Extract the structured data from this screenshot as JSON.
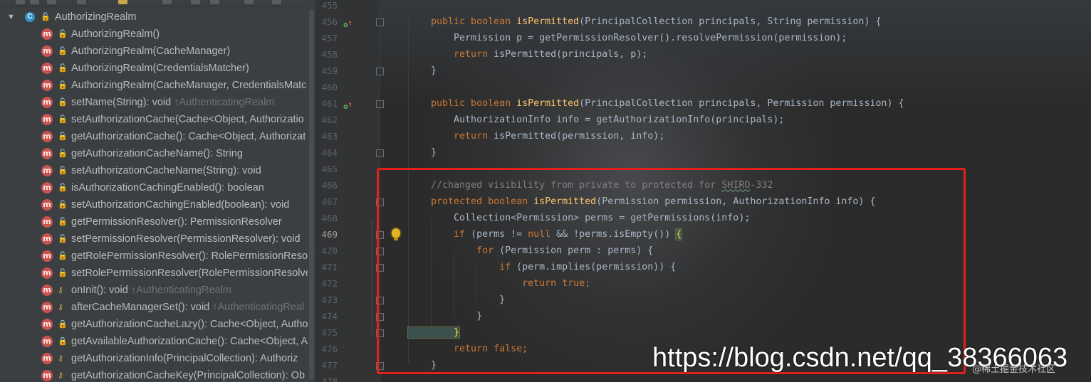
{
  "structure": {
    "root": {
      "label": "AuthorizingRealm",
      "class_icon_letter": "C",
      "arrow": "▼"
    },
    "member_icon_letter": "m",
    "visibility_glyphs": {
      "public": "🔓",
      "protected": "⚷",
      "private": "🔒"
    },
    "items": [
      {
        "signature": "AuthorizingRealm()",
        "inherited": "",
        "visibility": "public"
      },
      {
        "signature": "AuthorizingRealm(CacheManager)",
        "inherited": "",
        "visibility": "public"
      },
      {
        "signature": "AuthorizingRealm(CredentialsMatcher)",
        "inherited": "",
        "visibility": "public"
      },
      {
        "signature": "AuthorizingRealm(CacheManager, CredentialsMatc",
        "inherited": "",
        "visibility": "public"
      },
      {
        "signature": "setName(String): void ",
        "inherited": "↑AuthenticatingRealm",
        "visibility": "public"
      },
      {
        "signature": "setAuthorizationCache(Cache<Object, Authorizatio",
        "inherited": "",
        "visibility": "public"
      },
      {
        "signature": "getAuthorizationCache(): Cache<Object, Authorizat",
        "inherited": "",
        "visibility": "public"
      },
      {
        "signature": "getAuthorizationCacheName(): String",
        "inherited": "",
        "visibility": "public"
      },
      {
        "signature": "setAuthorizationCacheName(String): void",
        "inherited": "",
        "visibility": "public"
      },
      {
        "signature": "isAuthorizationCachingEnabled(): boolean",
        "inherited": "",
        "visibility": "public"
      },
      {
        "signature": "setAuthorizationCachingEnabled(boolean): void",
        "inherited": "",
        "visibility": "public"
      },
      {
        "signature": "getPermissionResolver(): PermissionResolver",
        "inherited": "",
        "visibility": "public"
      },
      {
        "signature": "setPermissionResolver(PermissionResolver): void",
        "inherited": "",
        "visibility": "public"
      },
      {
        "signature": "getRolePermissionResolver(): RolePermissionResolv",
        "inherited": "",
        "visibility": "public"
      },
      {
        "signature": "setRolePermissionResolver(RolePermissionResolver",
        "inherited": "",
        "visibility": "public"
      },
      {
        "signature": "onInit(): void ",
        "inherited": "↑AuthenticatingRealm",
        "visibility": "protected"
      },
      {
        "signature": "afterCacheManagerSet(): void ",
        "inherited": "↑AuthenticatingReal",
        "visibility": "protected"
      },
      {
        "signature": "getAuthorizationCacheLazy(): Cache<Object, Autho",
        "inherited": "",
        "visibility": "private"
      },
      {
        "signature": "getAvailableAuthorizationCache(): Cache<Object, A",
        "inherited": "",
        "visibility": "private"
      },
      {
        "signature": "getAuthorizationInfo(PrincipalCollection): Authoriz",
        "inherited": "",
        "visibility": "protected"
      },
      {
        "signature": "getAuthorizationCacheKey(PrincipalCollection): Ob",
        "inherited": "",
        "visibility": "protected"
      }
    ]
  },
  "editor": {
    "lines": [
      {
        "num": "455",
        "tokens": []
      },
      {
        "num": "456",
        "gutter_icon": "override",
        "tokens": [
          [
            "kw",
            "    public boolean "
          ],
          [
            "fn",
            "isPermitted"
          ],
          [
            "t",
            "(PrincipalCollection principals, String permission) {"
          ]
        ]
      },
      {
        "num": "457",
        "tokens": [
          [
            "t",
            "        Permission p = getPermissionResolver().resolvePermission(permission);"
          ]
        ]
      },
      {
        "num": "458",
        "tokens": [
          [
            "kw",
            "        return "
          ],
          [
            "t",
            "isPermitted(principals, p);"
          ]
        ]
      },
      {
        "num": "459",
        "tokens": [
          [
            "t",
            "    }"
          ]
        ]
      },
      {
        "num": "460",
        "tokens": []
      },
      {
        "num": "461",
        "gutter_icon": "override",
        "tokens": [
          [
            "kw",
            "    public boolean "
          ],
          [
            "fn",
            "isPermitted"
          ],
          [
            "t",
            "(PrincipalCollection principals, Permission permission) {"
          ]
        ]
      },
      {
        "num": "462",
        "tokens": [
          [
            "t",
            "        AuthorizationInfo info = getAuthorizationInfo(principals);"
          ]
        ]
      },
      {
        "num": "463",
        "tokens": [
          [
            "kw",
            "        return "
          ],
          [
            "t",
            "isPermitted(permission, info);"
          ]
        ]
      },
      {
        "num": "464",
        "tokens": [
          [
            "t",
            "    }"
          ]
        ]
      },
      {
        "num": "465",
        "tokens": []
      },
      {
        "num": "466",
        "tokens": [
          [
            "cm",
            "    //changed visibility from private to protected for "
          ],
          [
            "cmu",
            "SHIRO"
          ],
          [
            "cm",
            "-332"
          ]
        ]
      },
      {
        "num": "467",
        "tokens": [
          [
            "kw",
            "    protected boolean "
          ],
          [
            "fn",
            "isPermitted"
          ],
          [
            "t",
            "(Permission permission, AuthorizationInfo info) {"
          ]
        ]
      },
      {
        "num": "468",
        "tokens": [
          [
            "t",
            "        Collection<Permission> perms = getPermissions(info);"
          ]
        ]
      },
      {
        "num": "469",
        "current": true,
        "bulb": true,
        "tokens": [
          [
            "kw",
            "        if "
          ],
          [
            "t",
            "(perms != "
          ],
          [
            "kw",
            "null "
          ],
          [
            "t",
            "&& !perms.isEmpty()) "
          ],
          [
            "hl",
            "{"
          ]
        ]
      },
      {
        "num": "470",
        "tokens": [
          [
            "kw",
            "            for "
          ],
          [
            "t",
            "(Permission perm : perms) {"
          ]
        ]
      },
      {
        "num": "471",
        "tokens": [
          [
            "kw",
            "                if "
          ],
          [
            "t",
            "(perm.implies(permission)) {"
          ]
        ]
      },
      {
        "num": "472",
        "tokens": [
          [
            "kw",
            "                    return true;"
          ]
        ]
      },
      {
        "num": "473",
        "tokens": [
          [
            "t",
            "                }"
          ]
        ]
      },
      {
        "num": "474",
        "tokens": [
          [
            "t",
            "            }"
          ]
        ]
      },
      {
        "num": "475",
        "tokens": [
          [
            "hl",
            "        }"
          ]
        ]
      },
      {
        "num": "476",
        "tokens": [
          [
            "kw",
            "        return false;"
          ]
        ]
      },
      {
        "num": "477",
        "tokens": [
          [
            "t",
            "    }"
          ]
        ]
      },
      {
        "num": "478",
        "tokens": []
      }
    ]
  },
  "watermark": {
    "url": "https://blog.csdn.net/qq_38366063",
    "secondary": "@稀土掘金技术社区"
  }
}
